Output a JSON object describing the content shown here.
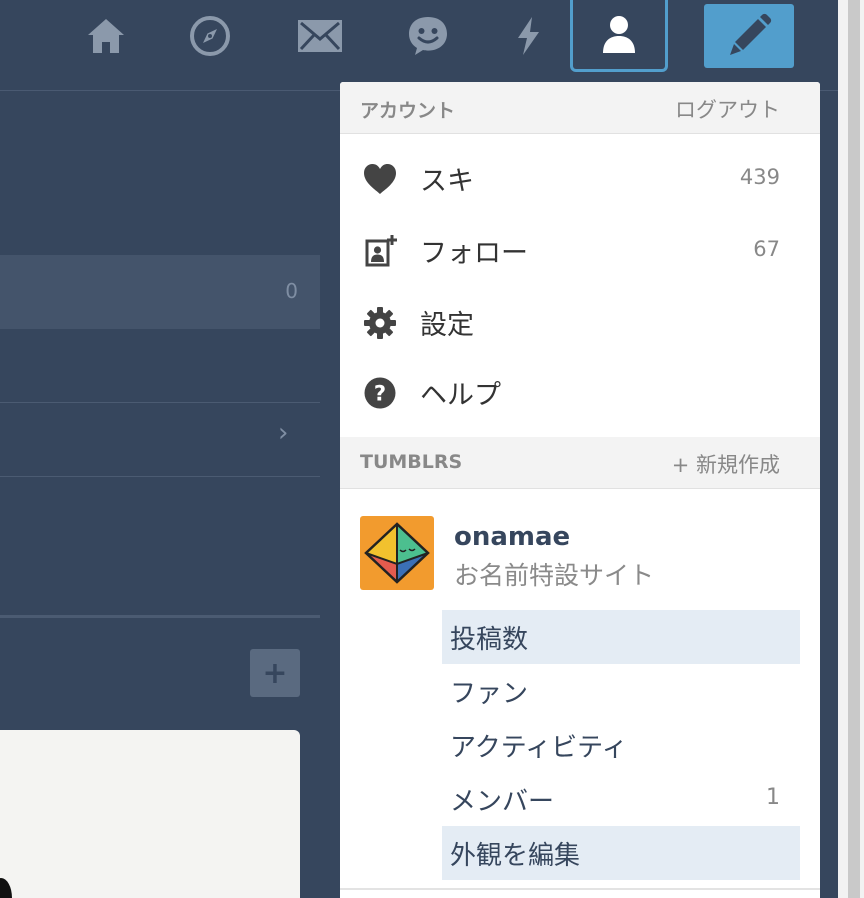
{
  "colors": {
    "background": "#36465d",
    "accent": "#529ecc",
    "dropdown_bg": "#ffffff",
    "section_header_bg": "#f3f3f3",
    "active_sub_item_bg": "#e4ecf4",
    "avatar_bg": "#f29b2e"
  },
  "nav": {
    "icons": [
      "home-icon",
      "explore-icon",
      "inbox-icon",
      "messaging-icon",
      "activity-icon",
      "account-icon",
      "compose-icon"
    ],
    "active": "account-icon"
  },
  "left_panel": {
    "highlight_count": "0",
    "chevron": "›",
    "plus": "+"
  },
  "dropdown": {
    "account_header": {
      "label": "アカウント",
      "logout": "ログアウト"
    },
    "account_items": [
      {
        "icon": "heart-icon",
        "label": "スキ",
        "count": "439"
      },
      {
        "icon": "follow-icon",
        "label": "フォロー",
        "count": "67"
      },
      {
        "icon": "gear-icon",
        "label": "設定",
        "count": ""
      },
      {
        "icon": "help-icon",
        "label": "ヘルプ",
        "count": ""
      }
    ],
    "tumblrs_header": {
      "label": "TUMBLRS",
      "new": "+ 新規作成"
    },
    "blog": {
      "name": "onamae",
      "title": "お名前特設サイト",
      "items": [
        {
          "label": "投稿数",
          "count": "",
          "active": true
        },
        {
          "label": "ファン",
          "count": "",
          "active": false
        },
        {
          "label": "アクティビティ",
          "count": "",
          "active": false
        },
        {
          "label": "メンバー",
          "count": "1",
          "active": false
        },
        {
          "label": "外観を編集",
          "count": "",
          "active": true
        }
      ]
    }
  }
}
